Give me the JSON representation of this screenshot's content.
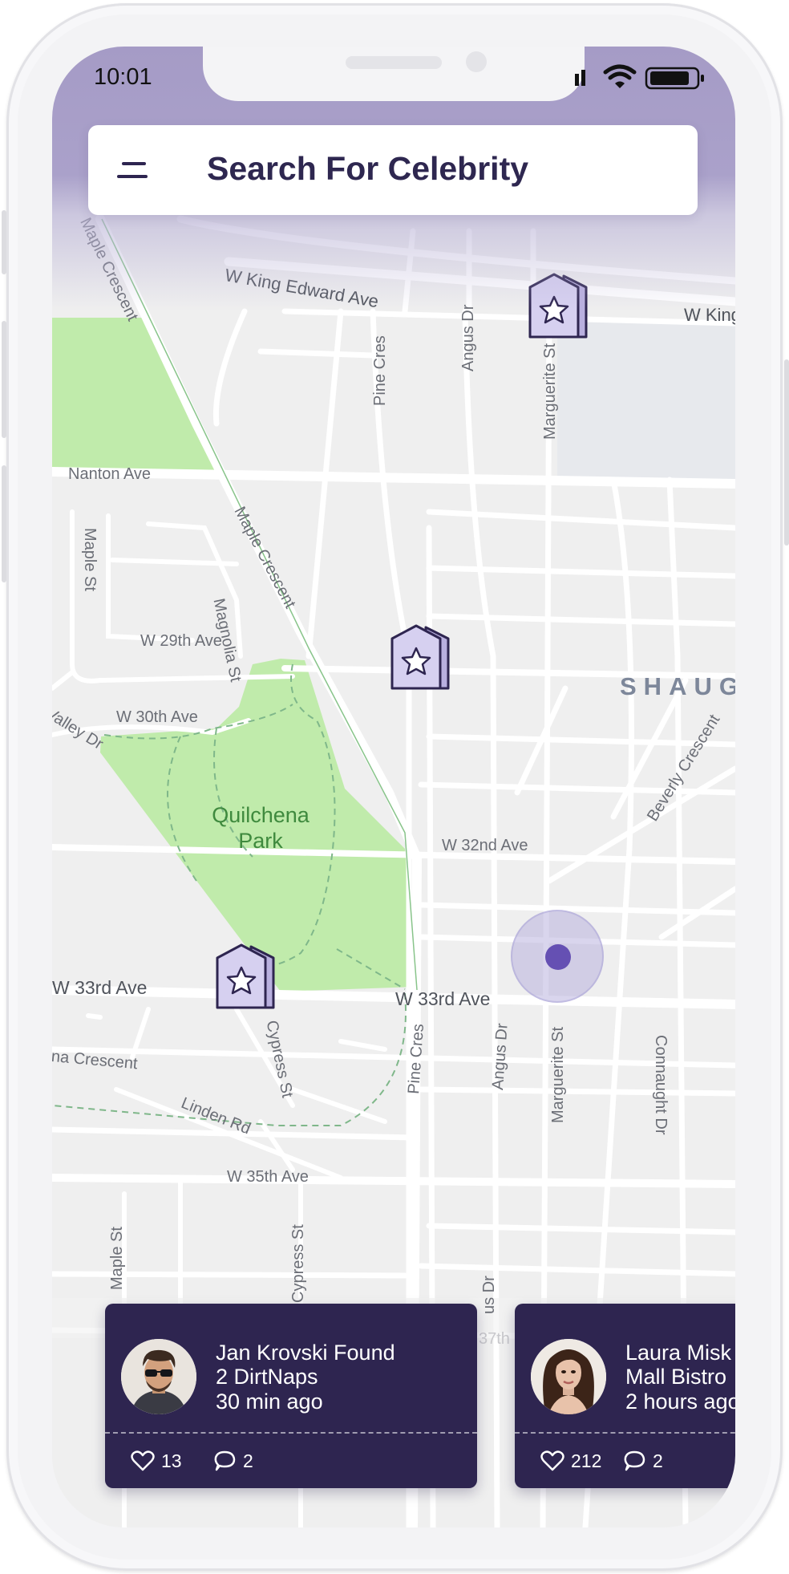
{
  "status_bar": {
    "time": "10:01"
  },
  "search": {
    "placeholder": "Search For Celebrity"
  },
  "map": {
    "streets": [
      "Maple Crescent",
      "W King Edward Ave",
      "W King",
      "Pine Cres",
      "Angus Dr",
      "Marguerite St",
      "Nanton Ave",
      "Maple Crescent",
      "Maple St",
      "Magnolia St",
      "W 29th Ave",
      "W 30th Ave",
      "Valley Dr",
      "Beverly Crescent",
      "W 32nd Ave",
      "W 33rd Ave",
      "W 33rd Ave",
      "Cypress St",
      "Pine Cres",
      "Angus Dr",
      "Marguerite St",
      "Connaught Dr",
      "na Crescent",
      "Linden Rd",
      "W 35th Ave",
      "Maple St",
      "Cypress St",
      "us Dr",
      "37th"
    ],
    "park_name": "Quilchena Park",
    "neighborhood": "SHAUG"
  },
  "colors": {
    "accent": "#2e2550",
    "brand_purple": "#a59bc6",
    "location_dot": "#6550b3",
    "park_green": "#c0ebab"
  },
  "cards": [
    {
      "avatar_icon": "male-avatar",
      "line1": "Jan Krovski Found",
      "line2": "2 DirtNaps",
      "line3": "30 min ago",
      "likes": "13",
      "comments": "2"
    },
    {
      "avatar_icon": "female-avatar",
      "line1": "Laura Misk",
      "line2": "Mall Bistro",
      "line3": "2 hours ago",
      "likes": "212",
      "comments": "2"
    }
  ]
}
